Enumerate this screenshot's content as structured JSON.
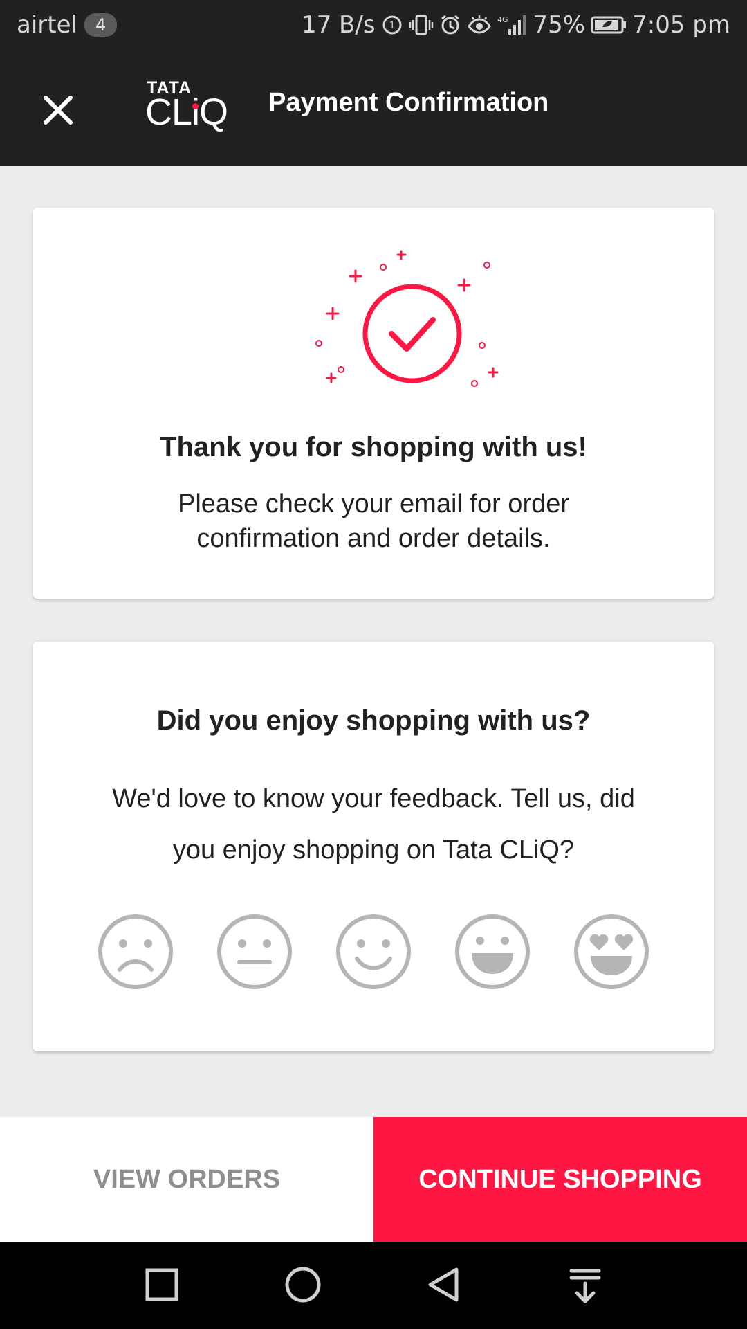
{
  "status_bar": {
    "carrier": "airtel",
    "sim_badge": "4",
    "speed": "17 B/s",
    "network": "4G",
    "battery": "75%",
    "time": "7:05 pm"
  },
  "app_bar": {
    "logo_top": "TATA",
    "logo_bottom": "CLiQ",
    "title": "Payment Confirmation"
  },
  "confirmation_card": {
    "heading": "Thank you for shopping with us!",
    "message_line1": "Please check your email for order",
    "message_line2": "confirmation and order details."
  },
  "feedback_card": {
    "heading": "Did you enjoy shopping with us?",
    "message_line1": "We'd love to know your feedback. Tell us, did",
    "message_line2": "you enjoy shopping on Tata CLiQ?",
    "ratings": [
      "sad-face-icon",
      "neutral-face-icon",
      "smile-face-icon",
      "happy-face-icon",
      "heart-eyes-face-icon"
    ]
  },
  "actions": {
    "view_orders": "VIEW ORDERS",
    "continue_shopping": "CONTINUE SHOPPING"
  },
  "colors": {
    "accent": "#ff1744",
    "app_bar": "#212121",
    "background": "#ececec",
    "face_gray": "#b5b5b5"
  }
}
